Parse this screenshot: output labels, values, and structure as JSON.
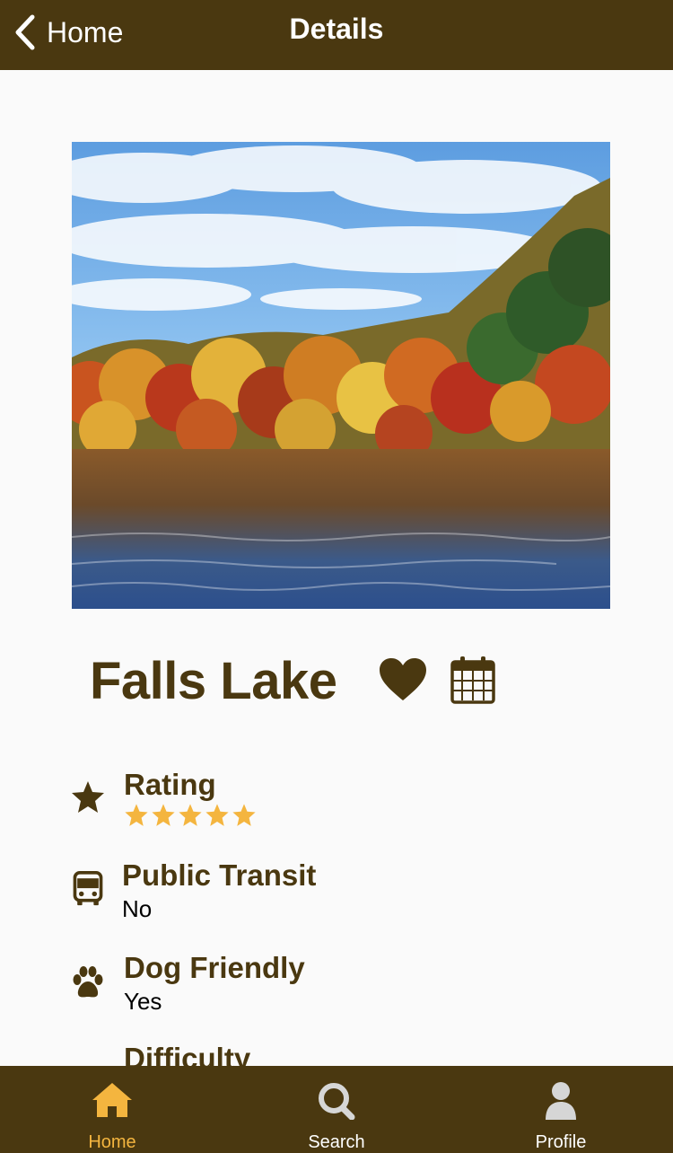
{
  "header": {
    "back_label": "Home",
    "title": "Details"
  },
  "place": {
    "name": "Falls Lake"
  },
  "info": [
    {
      "label": "Rating",
      "icon": "star-icon",
      "rating": 5
    },
    {
      "label": "Public Transit",
      "icon": "bus-icon",
      "value": "No"
    },
    {
      "label": "Dog Friendly",
      "icon": "paw-icon",
      "value": "Yes"
    },
    {
      "label": "Difficulty",
      "icon": "difficulty-icon"
    }
  ],
  "tabs": [
    {
      "label": "Home",
      "icon": "home-icon",
      "active": true
    },
    {
      "label": "Search",
      "icon": "search-icon",
      "active": false
    },
    {
      "label": "Profile",
      "icon": "profile-icon",
      "active": false
    }
  ],
  "colors": {
    "brand_brown": "#4a3810",
    "accent_gold": "#f4b53f",
    "inactive_icon": "#d6d6d6",
    "background": "#fafafa"
  }
}
